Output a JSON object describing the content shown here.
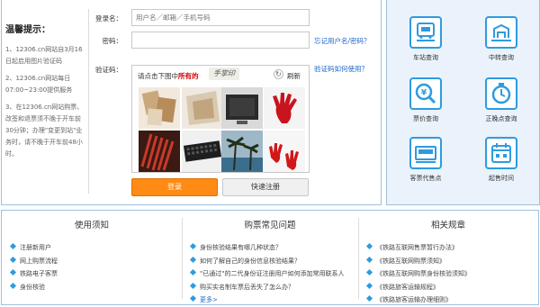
{
  "tips": {
    "title": "温馨提示：",
    "items": [
      "1、12306.cn网站自3月16日起启用图片验证码",
      "2、12306.cn网站每日07:00~23:00提供服务",
      "3、在12306.cn网站购票、改签和退票须不晚于开车前30分钟；办理\"变更到站\"业务时，请不晚于开车前48小时。"
    ]
  },
  "login": {
    "username_label": "登录名：",
    "username_placeholder": "用户名／邮箱／手机号码",
    "password_label": "密码：",
    "forgot_link": "忘记用户名/密码？",
    "captcha_label": "验证码：",
    "captcha_help_link": "验证码如何使用？",
    "captcha_prompt_pre": "请点击下图中",
    "captcha_prompt_em": "所有的",
    "captcha_target": "手掌印",
    "captcha_refresh": "刷新",
    "login_button": "登录",
    "register_button": "快速注册"
  },
  "services": [
    {
      "label": "车站查询",
      "icon": "station-icon"
    },
    {
      "label": "中转查询",
      "icon": "transfer-icon"
    },
    {
      "label": "票价查询",
      "icon": "ticket-price-icon"
    },
    {
      "label": "正晚点查询",
      "icon": "clock-icon"
    },
    {
      "label": "客票代售点",
      "icon": "sale-agent-icon"
    },
    {
      "label": "起售时间",
      "icon": "sale-time-icon"
    }
  ],
  "info": {
    "notice": {
      "title": "使用须知",
      "items": [
        "注册新用户",
        "网上购票流程",
        "铁路电子客票",
        "身份核验"
      ]
    },
    "faq": {
      "title": "购票常见问题",
      "items": [
        "身份核验结果有哪几种状态？",
        "如何了解自己的身份信息核验结果？",
        "\"已通过\"的二代身份证注册用户如何添加常用联系人",
        "购买实名制车票后丢失了怎么办？"
      ],
      "more": "更多>"
    },
    "rules": {
      "title": "相关规章",
      "items": [
        "《铁路互联网售票暂行办法》",
        "《铁路互联网购票须知》",
        "《铁路互联网购票身份核验须知》",
        "《铁路旅客运输规程》",
        "《铁路旅客运输办理细则》"
      ]
    }
  }
}
